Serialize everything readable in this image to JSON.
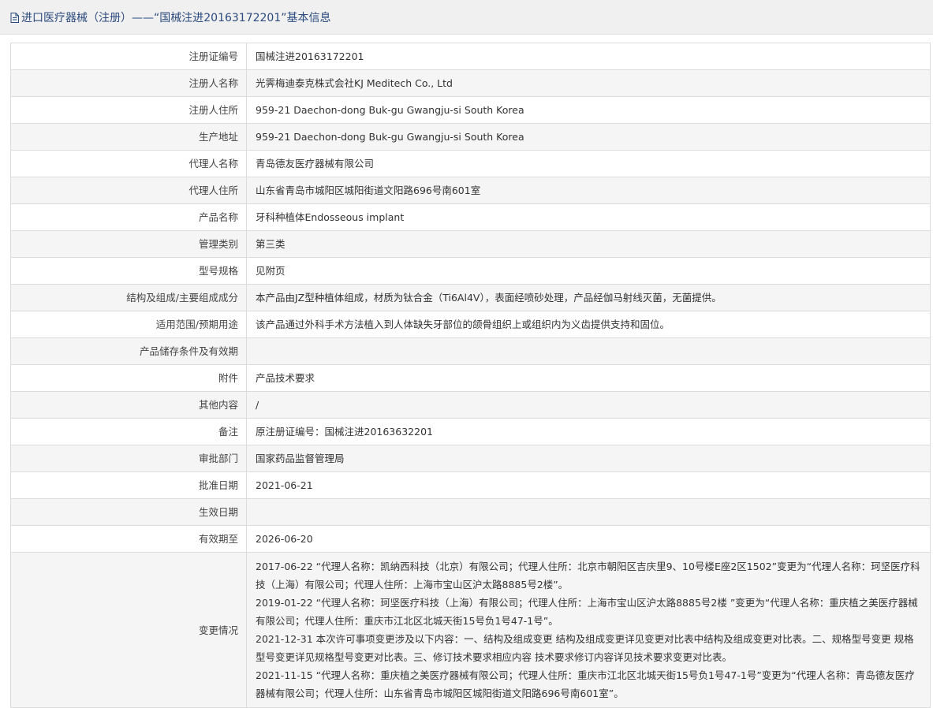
{
  "header": {
    "title": "进口医疗器械（注册）——“国械注进20163172201”基本信息"
  },
  "rows": [
    {
      "label": "注册证编号",
      "value": "国械注进20163172201"
    },
    {
      "label": "注册人名称",
      "value": "光霁梅迪泰克株式会社KJ Meditech Co., Ltd"
    },
    {
      "label": "注册人住所",
      "value": "959-21 Daechon-dong Buk-gu Gwangju-si South Korea"
    },
    {
      "label": "生产地址",
      "value": "959-21 Daechon-dong Buk-gu Gwangju-si South Korea"
    },
    {
      "label": "代理人名称",
      "value": "青岛德友医疗器械有限公司"
    },
    {
      "label": "代理人住所",
      "value": "山东省青岛市城阳区城阳街道文阳路696号南601室"
    },
    {
      "label": "产品名称",
      "value": "牙科种植体Endosseous implant"
    },
    {
      "label": "管理类别",
      "value": "第三类"
    },
    {
      "label": "型号规格",
      "value": "见附页"
    },
    {
      "label": "结构及组成/主要组成成分",
      "value": "本产品由JZ型种植体组成，材质为钛合金（Ti6Al4V），表面经喷砂处理，产品经伽马射线灭菌，无菌提供。"
    },
    {
      "label": "适用范围/预期用途",
      "value": "该产品通过外科手术方法植入到人体缺失牙部位的颌骨组织上或组织内为义齿提供支持和固位。"
    },
    {
      "label": "产品储存条件及有效期",
      "value": ""
    },
    {
      "label": "附件",
      "value": "产品技术要求"
    },
    {
      "label": "其他内容",
      "value": "/"
    },
    {
      "label": "备注",
      "value": "原注册证编号：国械注进20163632201"
    },
    {
      "label": "审批部门",
      "value": "国家药品监督管理局"
    },
    {
      "label": "批准日期",
      "value": "2021-06-21"
    },
    {
      "label": "生效日期",
      "value": ""
    },
    {
      "label": "有效期至",
      "value": "2026-06-20"
    }
  ],
  "change": {
    "label": "变更情况",
    "entries": [
      "2017-06-22 “代理人名称：凯纳西科技（北京）有限公司；代理人住所：北京市朝阳区吉庆里9、10号楼E座2区1502”变更为“代理人名称：珂坚医疗科技（上海）有限公司；代理人住所：上海市宝山区沪太路8885号2楼”。",
      "2019-01-22 “代理人名称：珂坚医疗科技（上海）有限公司；代理人住所：上海市宝山区沪太路8885号2楼 ”变更为“代理人名称：重庆植之美医疗器械有限公司；代理人住所：重庆市江北区北城天街15号负1号47-1号”。",
      "2021-12-31 本次许可事项变更涉及以下内容：一、结构及组成变更 结构及组成变更详见变更对比表中结构及组成变更对比表。二、规格型号变更 规格型号变更详见规格型号变更对比表。三、修订技术要求相应内容 技术要求修订内容详见技术要求变更对比表。",
      "2021-11-15 “代理人名称：重庆植之美医疗器械有限公司；代理人住所：重庆市江北区北城天街15号负1号47-1号”变更为“代理人名称：青岛德友医疗器械有限公司；代理人住所：山东省青岛市城阳区城阳街道文阳路696号南601室”。"
    ]
  }
}
